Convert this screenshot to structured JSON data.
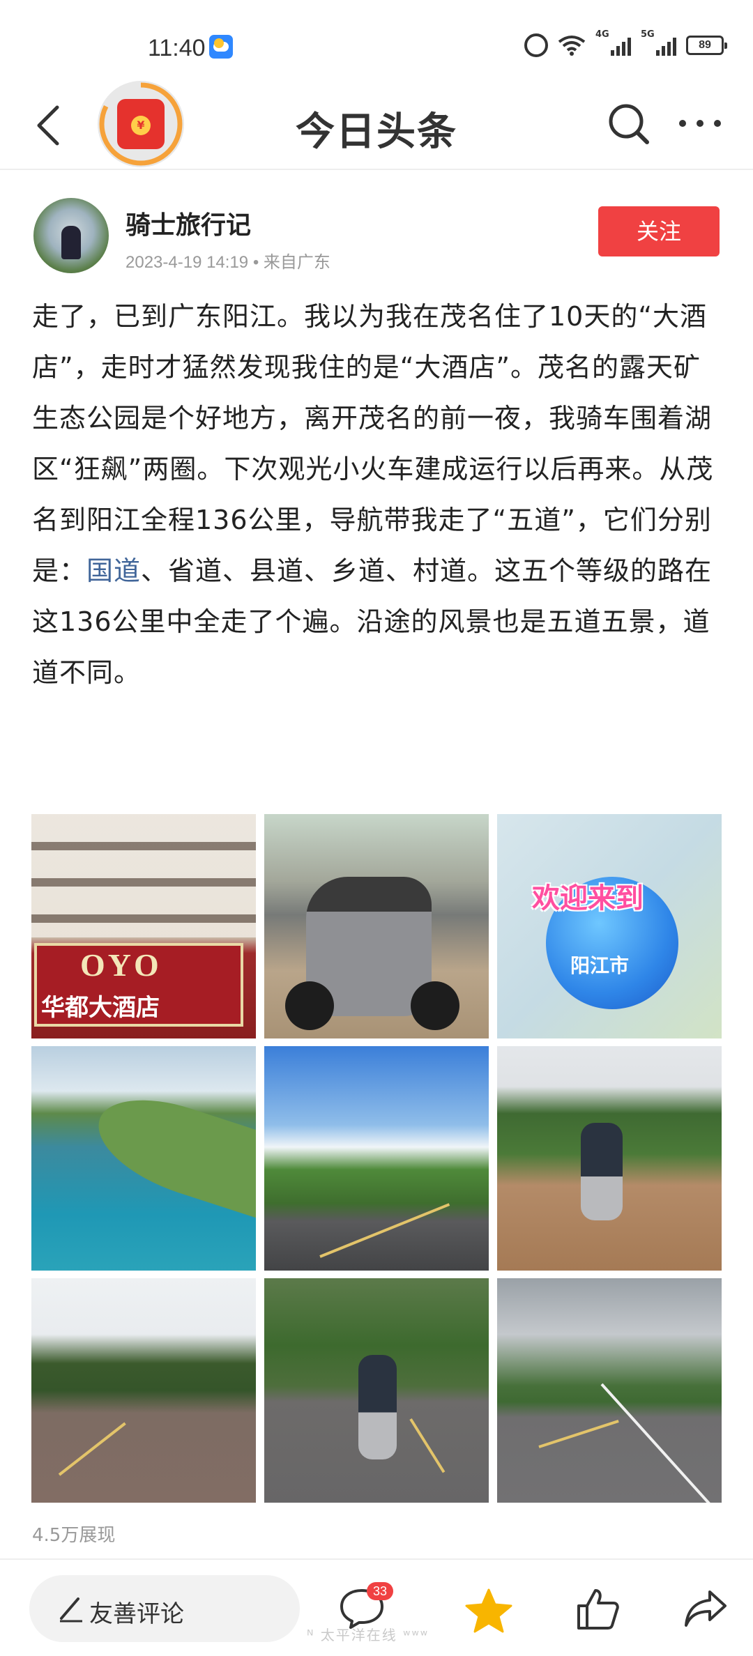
{
  "status_bar": {
    "time": "11:40",
    "signal1_label": "6",
    "signal2_label": "4G",
    "signal3_label": "5G",
    "battery": "89"
  },
  "nav": {
    "title": "今日头条",
    "redpacket_symbol": "¥"
  },
  "author": {
    "name": "骑士旅行记",
    "meta": "2023-4-19  14:19 • 来自广东",
    "follow_label": "关注"
  },
  "article": {
    "text_before_link": "走了，已到广东阳江。我以为我在茂名住了10天的“大酒店”，走时才猛然发现我住的是“大酒店”。茂名的露天矿生态公园是个好地方，离开茂名的前一夜，我骑车围着湖区“狂飙”两圈。下次观光小火车建成运行以后再来。从茂名到阳江全程136公里，导航带我走了“五道”，它们分别是：",
    "link_text": "国道",
    "text_after_link": "、省道、县道、乡道、村道。这五个等级的路在这136公里中全走了个遍。沿途的风景也是五道五景，道道不同。"
  },
  "photos": {
    "p1_sign": "OYO",
    "p1_hotel": "华都大酒店",
    "p3_welcome": "欢迎来到",
    "p3_city": "阳江市"
  },
  "impressions": "4.5万展现",
  "bottom_bar": {
    "comment_placeholder": "友善评论",
    "comment_count": "33"
  },
  "watermark": "ᴺ 太平洋在线 ʷʷʷ"
}
